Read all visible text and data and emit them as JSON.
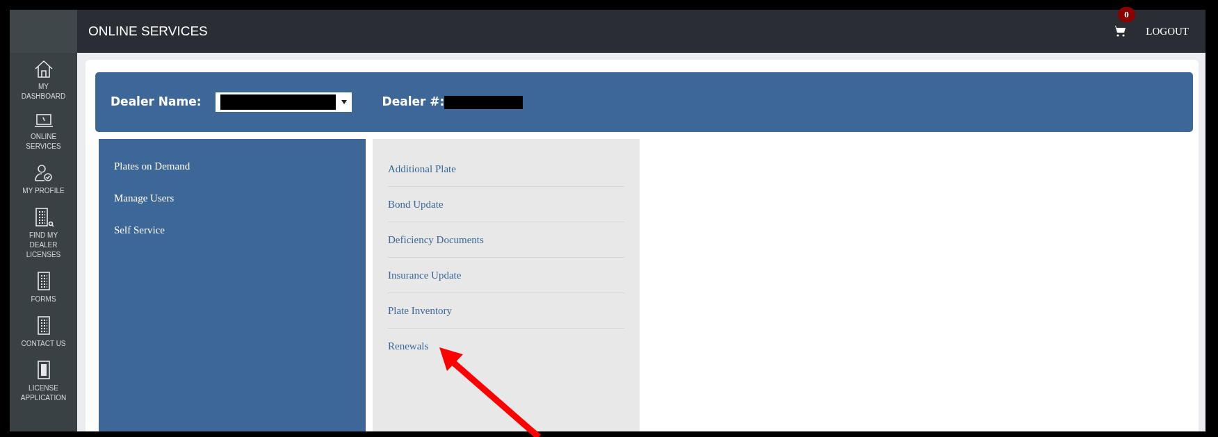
{
  "sidebar": {
    "items": [
      {
        "kind": "home",
        "label": "MY DASHBOARD"
      },
      {
        "kind": "laptop",
        "label": "ONLINE SERVICES"
      },
      {
        "kind": "user",
        "label": "MY PROFILE"
      },
      {
        "kind": "search",
        "label": "FIND MY DEALER LICENSES"
      },
      {
        "kind": "building",
        "label": "FORMS"
      },
      {
        "kind": "building",
        "label": "CONTACT US"
      },
      {
        "kind": "document",
        "label": "LICENSE APPLICATION"
      }
    ]
  },
  "header": {
    "title": "ONLINE SERVICES",
    "cart_count": "0",
    "logout": "LOGOUT"
  },
  "dealer_bar": {
    "name_label": "Dealer Name:",
    "number_label": "Dealer #:"
  },
  "menu": {
    "items": [
      "Plates on Demand",
      "Manage Users",
      "Self Service"
    ]
  },
  "submenu": {
    "items": [
      "Additional Plate",
      "Bond Update",
      "Deficiency Documents",
      "Insurance Update",
      "Plate Inventory",
      "Renewals"
    ]
  }
}
